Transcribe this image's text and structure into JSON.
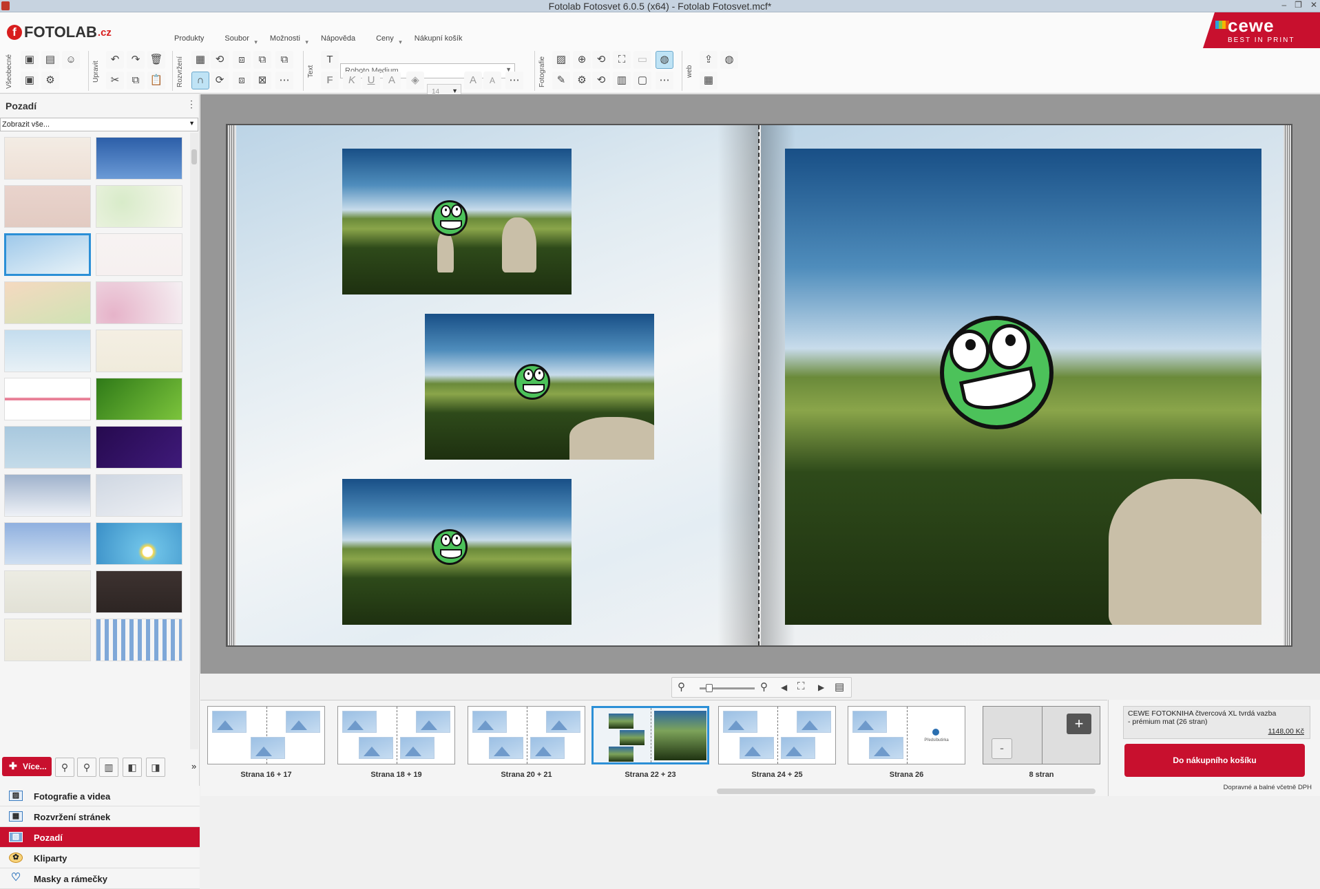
{
  "window": {
    "title": "Fotolab Fotosvet 6.0.5 (x64) - Fotolab Fotosvet.mcf*"
  },
  "logo": {
    "text": "FOTOLAB",
    "suffix": ".cz"
  },
  "brand": {
    "name": "cewe",
    "tagline": "BEST IN PRINT",
    "color": "#c8102e"
  },
  "menu": [
    "Produkty",
    "Soubor",
    "Možnosti",
    "Nápověda",
    "Ceny",
    "Nákupní košík"
  ],
  "ribbon": {
    "groups": [
      "Všeobecné",
      "Upravit",
      "Rozvržení",
      "Text",
      "Fotografie",
      "web"
    ],
    "font_name": "Roboto Medium",
    "font_size": "14",
    "text_buttons": [
      "F",
      "K",
      "U"
    ]
  },
  "left_panel": {
    "title": "Pozadí",
    "filter": "Zobrazit vše...",
    "more_button": "Více...",
    "selected_background_index": 4
  },
  "accordion": [
    {
      "label": "Fotografie a videa",
      "icon": "photo-icon"
    },
    {
      "label": "Rozvržení stránek",
      "icon": "layout-icon"
    },
    {
      "label": "Pozadí",
      "icon": "background-icon",
      "selected": true
    },
    {
      "label": "Kliparty",
      "icon": "clipart-icon"
    },
    {
      "label": "Masky a rámečky",
      "icon": "mask-icon"
    }
  ],
  "pages": [
    {
      "label": "Strana 16 + 17"
    },
    {
      "label": "Strana 18 + 19"
    },
    {
      "label": "Strana 20 + 21"
    },
    {
      "label": "Strana 22 + 23",
      "selected": true
    },
    {
      "label": "Strana 24 + 25"
    },
    {
      "label": "Strana 26"
    },
    {
      "label": "8 stran"
    }
  ],
  "cart": {
    "product": "CEWE FOTOKNIHA čtvercová XL tvrdá vazba - prémium mat  (26 stran)",
    "price": "1148,00 Kč",
    "button": "Do nákupního košíku",
    "note": "Dopravné a balné včetně DPH"
  },
  "page26_preview_text": "Předsíbutirka"
}
